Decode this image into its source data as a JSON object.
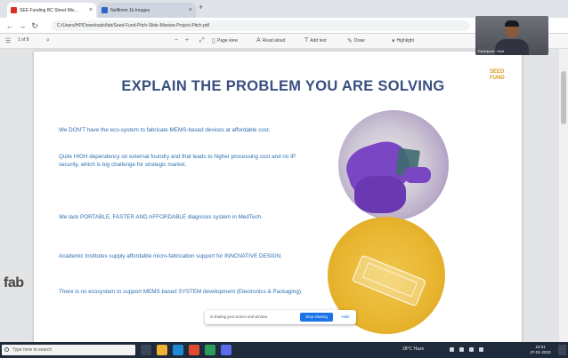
{
  "browser": {
    "tabs": [
      {
        "title": "SEE Funding BC Sheet Mis..."
      },
      {
        "title": "Netflimm 1k Images"
      }
    ],
    "url": "C:/Users/HP/Downloads/fab/Seed-Fund-Pitch-Slide-Mission-Project-Pitch.pdf"
  },
  "pdf_toolbar": {
    "page_field": "1 of 8",
    "page_view": "Page view",
    "read_aloud": "Read aloud",
    "add_text": "Add text",
    "draw": "Draw",
    "highlight": "Highlight"
  },
  "slide": {
    "title": "EXPLAIN THE PROBLEM YOU ARE SOLVING",
    "logo_text": "SEED FUND",
    "bullets": [
      "We DON'T have the eco-system to fabricate MEMS-based devices at affordable cost.",
      "Quite HIGH dependency on external foundry and that leads to higher processing cost and no IP security, which is big challenge for strategic market.",
      "We lack PORTABLE, FASTER AND AFFORDABLE diagnosis system in MedTech.",
      "Academic Institutes supply affordable micro-fabrication support for INNOVATIVE DESIGN.",
      "There is no ecosystem to support MEMS based SYSTEM development (Electronics & Packaging)."
    ],
    "footer_logo": "fab"
  },
  "share_notification": {
    "message": "is sharing your screen and window",
    "stop_button": "Stop sharing",
    "hide_button": "Hide"
  },
  "webcam": {
    "name": "Participant - Host"
  },
  "taskbar": {
    "search_placeholder": "Type here to search",
    "weather": "28°C Haze",
    "time": "10:31",
    "date": "27-01-2023"
  },
  "colors": {
    "slide_title": "#394f80",
    "bullet_text": "#2f6fb0",
    "accent_blue": "#1a73e8",
    "taskbar_bg": "#1f2a3a"
  }
}
